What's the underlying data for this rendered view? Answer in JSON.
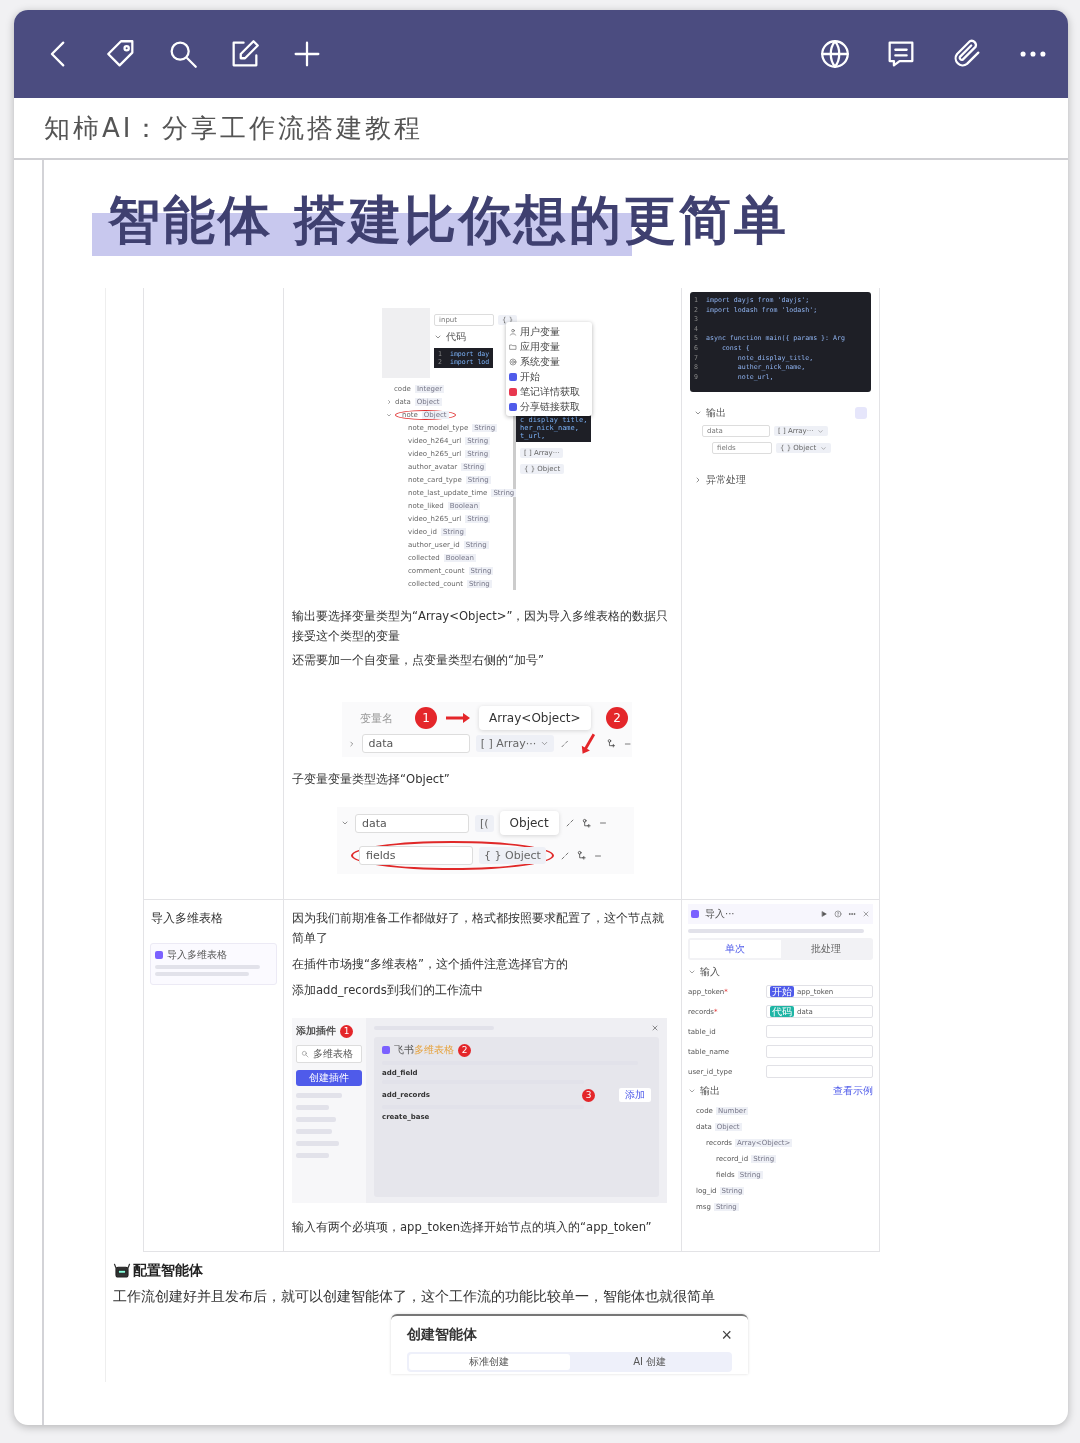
{
  "note_title": "知柿AI：分享工作流搭建教程",
  "heading": "智能体 搭建比你想的更简单",
  "row_1": {
    "variable_shot": {
      "input_value": "input",
      "type_pill": "{ }",
      "code_label": "代码",
      "code_lines": [
        {
          "no": "1",
          "code": "import day"
        },
        {
          "no": "2",
          "code": "import lod"
        }
      ],
      "code_tail": [
        "c display title,",
        "her_nick_name,",
        "t_url,"
      ],
      "type_pills": [
        "[ ] Array···",
        "{ } Object"
      ],
      "menu": [
        {
          "label": "用户变量",
          "kind": "user"
        },
        {
          "label": "应用变量",
          "kind": "folder"
        },
        {
          "label": "系统变量",
          "kind": "gear"
        },
        {
          "label": "开始",
          "kind": "node",
          "color": "#4f5bea"
        },
        {
          "label": "笔记详情获取",
          "kind": "node",
          "color": "#e8384f"
        },
        {
          "label": "分享链接获取",
          "kind": "node",
          "color": "#4f5bea"
        }
      ],
      "fields": [
        {
          "name": "code",
          "type": "Integer"
        },
        {
          "name": "data",
          "type": "Object",
          "expanded": false
        },
        {
          "name": "note",
          "type": "Object",
          "expanded": true,
          "circled": true,
          "children": [
            {
              "name": "note_model_type",
              "type": "String"
            },
            {
              "name": "video_h264_url",
              "type": "String"
            },
            {
              "name": "video_h265_url",
              "type": "String"
            },
            {
              "name": "author_avatar",
              "type": "String"
            },
            {
              "name": "note_card_type",
              "type": "String"
            },
            {
              "name": "note_last_update_time",
              "type": "String"
            },
            {
              "name": "note_liked",
              "type": "Boolean"
            },
            {
              "name": "video_h265_url",
              "type": "String"
            },
            {
              "name": "video_id",
              "type": "String"
            },
            {
              "name": "author_user_id",
              "type": "String"
            },
            {
              "name": "collected",
              "type": "Boolean"
            },
            {
              "name": "comment_count",
              "type": "String"
            },
            {
              "name": "collected_count",
              "type": "String"
            }
          ]
        }
      ]
    },
    "text_1": "输出要选择变量类型为“Array<Object>”，因为导入多维表格的数据只接受这个类型的变量",
    "text_2": "还需要加一个自变量，点变量类型右侧的“加号”",
    "diagram_1": {
      "column_label": "变量名",
      "steps": [
        "1",
        "2"
      ],
      "tooltip": "Array<Object>",
      "name": "data",
      "type": "[ ] Array···"
    },
    "text_3": "子变量变量类型选择“Object”",
    "diagram_2": {
      "tooltip": "Object",
      "rows": [
        {
          "name": "data",
          "type": "[(",
          "circled": false
        },
        {
          "name": "fields",
          "type": "{ } Object",
          "circled": true
        }
      ]
    },
    "code_shot": {
      "lines": [
        {
          "no": "1",
          "code": "import dayjs from 'dayjs';"
        },
        {
          "no": "2",
          "code": "import lodash from 'lodash';"
        },
        {
          "no": "3"
        },
        {
          "no": "4"
        },
        {
          "no": "5",
          "code": "async function main({ params }: Arg"
        },
        {
          "no": "6",
          "code": "    const {"
        },
        {
          "no": "7",
          "code": "        note_display_title,"
        },
        {
          "no": "8",
          "code": "        auther_nick_name,"
        },
        {
          "no": "9",
          "code": "        note_url,"
        }
      ]
    },
    "output_panel": {
      "title": "输出",
      "rows": [
        {
          "name": "data",
          "type": "[ ] Array···"
        },
        {
          "name": "fields",
          "type": "{ } Object"
        }
      ],
      "error_section": "异常处理"
    }
  },
  "row_2": {
    "label": "导入多维表格",
    "node_card": {
      "title": "导入多维表格"
    },
    "paragraphs": [
      "因为我们前期准备工作都做好了，格式都按照要求配置了，这个节点就简单了",
      "在插件市场搜“多维表格”，这个插件注意选择官方的",
      "添加add_records到我们的工作流中"
    ],
    "plugin_shot": {
      "sidebar_title": "添加插件",
      "search_value": "多维表格",
      "create_button": "创建插件",
      "plugin_prefix": "飞书",
      "plugin_highlight": "多维表格",
      "markers": [
        "1",
        "2",
        "3"
      ],
      "tools": [
        {
          "name": "add_field"
        },
        {
          "name": "add_records",
          "button": "添加"
        },
        {
          "name": "create_base"
        }
      ]
    },
    "text_after": "输入有两个必填项，app_token选择开始节点的填入的“app_token”",
    "node_panel": {
      "title": "导入···",
      "tabs": [
        {
          "label": "单次",
          "selected": true
        },
        {
          "label": "批处理",
          "selected": false
        }
      ],
      "input_title": "输入",
      "required_mark": "*",
      "inputs": [
        {
          "name": "app_token",
          "required": true,
          "source": "开始",
          "value": "app_token",
          "color": "#4f5bea"
        },
        {
          "name": "records",
          "required": true,
          "source": "代码",
          "value": "data",
          "color": "#1fb5a5"
        },
        {
          "name": "table_id",
          "required": false
        },
        {
          "name": "table_name",
          "required": false
        },
        {
          "name": "user_id_type",
          "required": false
        }
      ],
      "output_title": "输出",
      "example_link": "查看示例",
      "outputs": [
        {
          "name": "code",
          "type": "Number"
        },
        {
          "name": "data",
          "type": "Object",
          "children": [
            {
              "name": "records",
              "type": "Array<Object>",
              "children": [
                {
                  "name": "record_id",
                  "type": "String"
                },
                {
                  "name": "fields",
                  "type": "String"
                }
              ]
            }
          ]
        },
        {
          "name": "log_id",
          "type": "String"
        },
        {
          "name": "msg",
          "type": "String"
        }
      ]
    }
  },
  "section": {
    "title": "配置智能体",
    "text": "工作流创建好并且发布后，就可以创建智能体了，这个工作流的功能比较单一，智能体也就很简单",
    "dialog": {
      "title": "创建智能体",
      "close": "×",
      "tabs": [
        {
          "label": "标准创建",
          "selected": true
        },
        {
          "label": "AI 创建",
          "selected": false
        }
      ]
    }
  }
}
